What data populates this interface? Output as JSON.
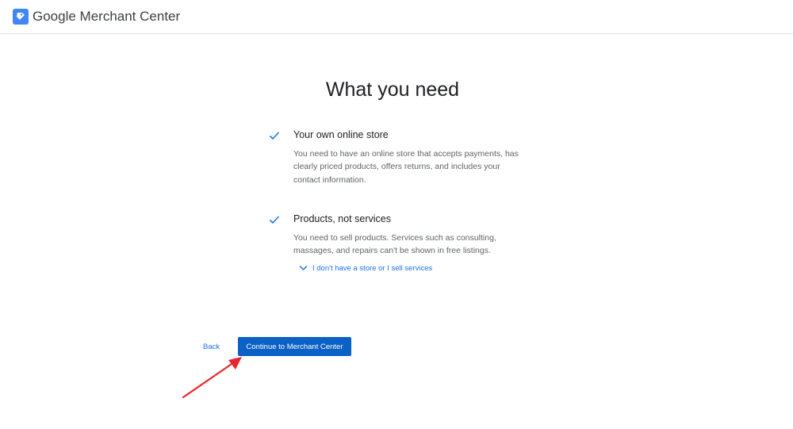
{
  "header": {
    "app_title": "Google Merchant Center",
    "logo_icon": "merchant-center-tag-icon"
  },
  "main": {
    "title": "What you need",
    "items": [
      {
        "icon": "check-icon",
        "title": "Your own online store",
        "description": "You need to have an online store that accepts payments, has clearly priced products, offers returns, and includes your contact information."
      },
      {
        "icon": "check-icon",
        "title": "Products, not services",
        "description": "You need to sell products. Services such as consulting, massages, and repairs can't be shown in free listings."
      }
    ],
    "help_link": {
      "icon": "chevron-down-icon",
      "label": "I don't have a store or I sell services"
    }
  },
  "footer": {
    "back_label": "Back",
    "continue_label": "Continue to Merchant Center"
  },
  "colors": {
    "accent": "#1a73e8",
    "button": "#0b61c5",
    "annotation_arrow": "#e8262b"
  }
}
